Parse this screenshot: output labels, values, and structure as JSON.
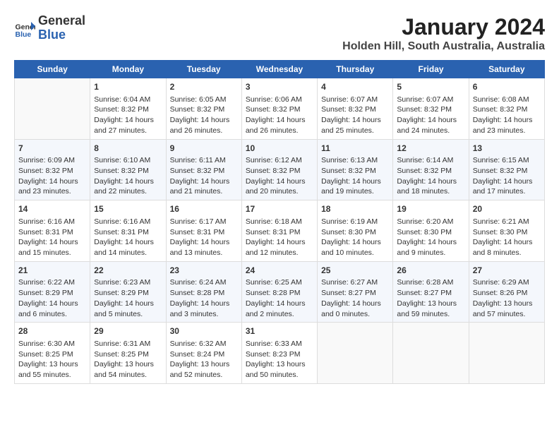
{
  "logo": {
    "line1": "General",
    "line2": "Blue"
  },
  "title": "January 2024",
  "subtitle": "Holden Hill, South Australia, Australia",
  "weekdays": [
    "Sunday",
    "Monday",
    "Tuesday",
    "Wednesday",
    "Thursday",
    "Friday",
    "Saturday"
  ],
  "weeks": [
    [
      {
        "day": "",
        "sunrise": "",
        "sunset": "",
        "daylight": ""
      },
      {
        "day": "1",
        "sunrise": "Sunrise: 6:04 AM",
        "sunset": "Sunset: 8:32 PM",
        "daylight": "Daylight: 14 hours and 27 minutes."
      },
      {
        "day": "2",
        "sunrise": "Sunrise: 6:05 AM",
        "sunset": "Sunset: 8:32 PM",
        "daylight": "Daylight: 14 hours and 26 minutes."
      },
      {
        "day": "3",
        "sunrise": "Sunrise: 6:06 AM",
        "sunset": "Sunset: 8:32 PM",
        "daylight": "Daylight: 14 hours and 26 minutes."
      },
      {
        "day": "4",
        "sunrise": "Sunrise: 6:07 AM",
        "sunset": "Sunset: 8:32 PM",
        "daylight": "Daylight: 14 hours and 25 minutes."
      },
      {
        "day": "5",
        "sunrise": "Sunrise: 6:07 AM",
        "sunset": "Sunset: 8:32 PM",
        "daylight": "Daylight: 14 hours and 24 minutes."
      },
      {
        "day": "6",
        "sunrise": "Sunrise: 6:08 AM",
        "sunset": "Sunset: 8:32 PM",
        "daylight": "Daylight: 14 hours and 23 minutes."
      }
    ],
    [
      {
        "day": "7",
        "sunrise": "Sunrise: 6:09 AM",
        "sunset": "Sunset: 8:32 PM",
        "daylight": "Daylight: 14 hours and 23 minutes."
      },
      {
        "day": "8",
        "sunrise": "Sunrise: 6:10 AM",
        "sunset": "Sunset: 8:32 PM",
        "daylight": "Daylight: 14 hours and 22 minutes."
      },
      {
        "day": "9",
        "sunrise": "Sunrise: 6:11 AM",
        "sunset": "Sunset: 8:32 PM",
        "daylight": "Daylight: 14 hours and 21 minutes."
      },
      {
        "day": "10",
        "sunrise": "Sunrise: 6:12 AM",
        "sunset": "Sunset: 8:32 PM",
        "daylight": "Daylight: 14 hours and 20 minutes."
      },
      {
        "day": "11",
        "sunrise": "Sunrise: 6:13 AM",
        "sunset": "Sunset: 8:32 PM",
        "daylight": "Daylight: 14 hours and 19 minutes."
      },
      {
        "day": "12",
        "sunrise": "Sunrise: 6:14 AM",
        "sunset": "Sunset: 8:32 PM",
        "daylight": "Daylight: 14 hours and 18 minutes."
      },
      {
        "day": "13",
        "sunrise": "Sunrise: 6:15 AM",
        "sunset": "Sunset: 8:32 PM",
        "daylight": "Daylight: 14 hours and 17 minutes."
      }
    ],
    [
      {
        "day": "14",
        "sunrise": "Sunrise: 6:16 AM",
        "sunset": "Sunset: 8:31 PM",
        "daylight": "Daylight: 14 hours and 15 minutes."
      },
      {
        "day": "15",
        "sunrise": "Sunrise: 6:16 AM",
        "sunset": "Sunset: 8:31 PM",
        "daylight": "Daylight: 14 hours and 14 minutes."
      },
      {
        "day": "16",
        "sunrise": "Sunrise: 6:17 AM",
        "sunset": "Sunset: 8:31 PM",
        "daylight": "Daylight: 14 hours and 13 minutes."
      },
      {
        "day": "17",
        "sunrise": "Sunrise: 6:18 AM",
        "sunset": "Sunset: 8:31 PM",
        "daylight": "Daylight: 14 hours and 12 minutes."
      },
      {
        "day": "18",
        "sunrise": "Sunrise: 6:19 AM",
        "sunset": "Sunset: 8:30 PM",
        "daylight": "Daylight: 14 hours and 10 minutes."
      },
      {
        "day": "19",
        "sunrise": "Sunrise: 6:20 AM",
        "sunset": "Sunset: 8:30 PM",
        "daylight": "Daylight: 14 hours and 9 minutes."
      },
      {
        "day": "20",
        "sunrise": "Sunrise: 6:21 AM",
        "sunset": "Sunset: 8:30 PM",
        "daylight": "Daylight: 14 hours and 8 minutes."
      }
    ],
    [
      {
        "day": "21",
        "sunrise": "Sunrise: 6:22 AM",
        "sunset": "Sunset: 8:29 PM",
        "daylight": "Daylight: 14 hours and 6 minutes."
      },
      {
        "day": "22",
        "sunrise": "Sunrise: 6:23 AM",
        "sunset": "Sunset: 8:29 PM",
        "daylight": "Daylight: 14 hours and 5 minutes."
      },
      {
        "day": "23",
        "sunrise": "Sunrise: 6:24 AM",
        "sunset": "Sunset: 8:28 PM",
        "daylight": "Daylight: 14 hours and 3 minutes."
      },
      {
        "day": "24",
        "sunrise": "Sunrise: 6:25 AM",
        "sunset": "Sunset: 8:28 PM",
        "daylight": "Daylight: 14 hours and 2 minutes."
      },
      {
        "day": "25",
        "sunrise": "Sunrise: 6:27 AM",
        "sunset": "Sunset: 8:27 PM",
        "daylight": "Daylight: 14 hours and 0 minutes."
      },
      {
        "day": "26",
        "sunrise": "Sunrise: 6:28 AM",
        "sunset": "Sunset: 8:27 PM",
        "daylight": "Daylight: 13 hours and 59 minutes."
      },
      {
        "day": "27",
        "sunrise": "Sunrise: 6:29 AM",
        "sunset": "Sunset: 8:26 PM",
        "daylight": "Daylight: 13 hours and 57 minutes."
      }
    ],
    [
      {
        "day": "28",
        "sunrise": "Sunrise: 6:30 AM",
        "sunset": "Sunset: 8:25 PM",
        "daylight": "Daylight: 13 hours and 55 minutes."
      },
      {
        "day": "29",
        "sunrise": "Sunrise: 6:31 AM",
        "sunset": "Sunset: 8:25 PM",
        "daylight": "Daylight: 13 hours and 54 minutes."
      },
      {
        "day": "30",
        "sunrise": "Sunrise: 6:32 AM",
        "sunset": "Sunset: 8:24 PM",
        "daylight": "Daylight: 13 hours and 52 minutes."
      },
      {
        "day": "31",
        "sunrise": "Sunrise: 6:33 AM",
        "sunset": "Sunset: 8:23 PM",
        "daylight": "Daylight: 13 hours and 50 minutes."
      },
      {
        "day": "",
        "sunrise": "",
        "sunset": "",
        "daylight": ""
      },
      {
        "day": "",
        "sunrise": "",
        "sunset": "",
        "daylight": ""
      },
      {
        "day": "",
        "sunrise": "",
        "sunset": "",
        "daylight": ""
      }
    ]
  ]
}
